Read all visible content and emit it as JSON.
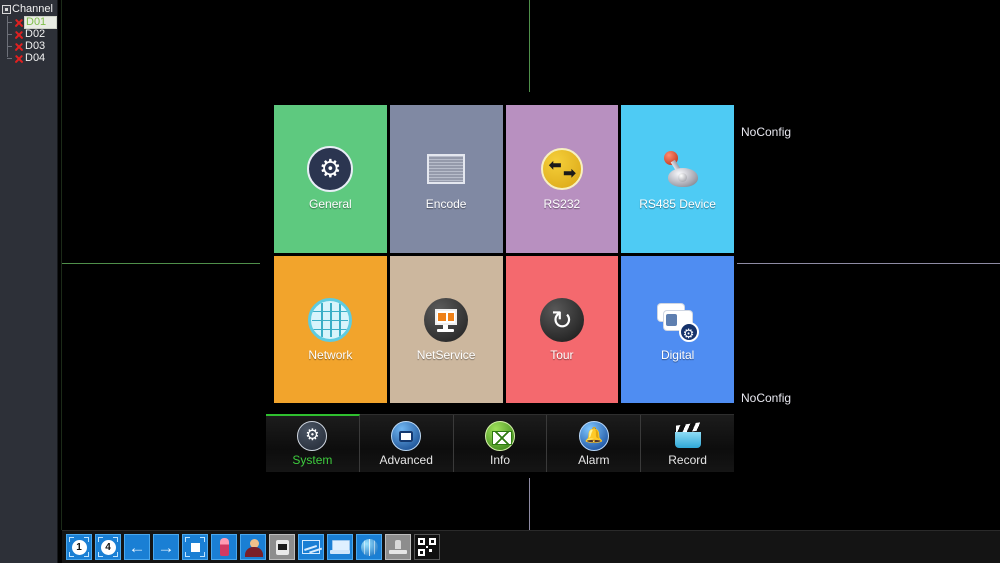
{
  "sidebar": {
    "root_label": "Channel",
    "root_icon": "checkbox-icon",
    "channels": [
      {
        "label": "D01",
        "status_icon": "red-x-icon",
        "selected": true
      },
      {
        "label": "D02",
        "status_icon": "red-x-icon",
        "selected": false
      },
      {
        "label": "D03",
        "status_icon": "red-x-icon",
        "selected": false
      },
      {
        "label": "D04",
        "status_icon": "red-x-icon",
        "selected": false
      }
    ]
  },
  "video": {
    "noconfig_top": "NoConfig",
    "noconfig_bottom": "NoConfig"
  },
  "menu": {
    "tiles": [
      {
        "label": "General",
        "icon": "gears-icon",
        "color": "#5ec97f"
      },
      {
        "label": "Encode",
        "icon": "encode-icon",
        "color": "#8089a3"
      },
      {
        "label": "RS232",
        "icon": "rs232-icon",
        "color": "#b890c0"
      },
      {
        "label": "RS485 Device",
        "icon": "joystick-icon",
        "color": "#4ecbf4"
      },
      {
        "label": "Network",
        "icon": "globe-icon",
        "color": "#f2a42c"
      },
      {
        "label": "NetService",
        "icon": "monitor-icon",
        "color": "#ccb79e"
      },
      {
        "label": "Tour",
        "icon": "refresh-icon",
        "color": "#f4696e"
      },
      {
        "label": "Digital",
        "icon": "camera-gear-icon",
        "color": "#4f8df2"
      }
    ]
  },
  "tabs": [
    {
      "label": "System",
      "icon": "system-gears-icon",
      "active": true
    },
    {
      "label": "Advanced",
      "icon": "toolbox-icon",
      "active": false
    },
    {
      "label": "Info",
      "icon": "info-envelope-icon",
      "active": false
    },
    {
      "label": "Alarm",
      "icon": "bell-icon",
      "active": false
    },
    {
      "label": "Record",
      "icon": "clapperboard-icon",
      "active": false
    }
  ],
  "taskbar": {
    "items": [
      {
        "icon": "single-view-icon",
        "label": "1"
      },
      {
        "icon": "quad-view-icon",
        "label": "4"
      },
      {
        "icon": "arrow-left-icon",
        "label": "←"
      },
      {
        "icon": "arrow-right-icon",
        "label": "→"
      },
      {
        "icon": "stop-record-icon",
        "label": ""
      },
      {
        "icon": "motion-person-icon",
        "label": ""
      },
      {
        "icon": "user-account-icon",
        "label": ""
      },
      {
        "icon": "device-icon",
        "label": ""
      },
      {
        "icon": "chart-icon",
        "label": ""
      },
      {
        "icon": "laptop-icon",
        "label": ""
      },
      {
        "icon": "network-globe-icon",
        "label": ""
      },
      {
        "icon": "tool-icon",
        "label": ""
      },
      {
        "icon": "qrcode-icon",
        "label": ""
      }
    ]
  },
  "accent": {
    "active_green": "#3ecb3e",
    "divider_green": "#4f8f4a",
    "divider_gray": "#8e8ba4",
    "taskbar_blue": "#1a7fd4"
  }
}
